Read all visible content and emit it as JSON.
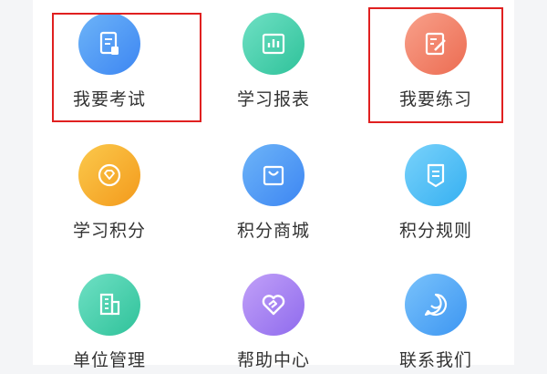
{
  "menu": {
    "items": [
      {
        "label": "我要考试",
        "icon": "exam-document-icon",
        "color_from": "#6db4f8",
        "color_to": "#3d86f2",
        "highlighted": true
      },
      {
        "label": "学习报表",
        "icon": "report-chart-icon",
        "color_from": "#6fe0c4",
        "color_to": "#2fc29a",
        "highlighted": false
      },
      {
        "label": "我要练习",
        "icon": "practice-edit-icon",
        "color_from": "#f8a08a",
        "color_to": "#ec6c52",
        "highlighted": true
      },
      {
        "label": "学习积分",
        "icon": "points-diamond-icon",
        "color_from": "#fbc94c",
        "color_to": "#f39a1c",
        "highlighted": false
      },
      {
        "label": "积分商城",
        "icon": "shop-bag-icon",
        "color_from": "#6db4f8",
        "color_to": "#3d86f2",
        "highlighted": false
      },
      {
        "label": "积分规则",
        "icon": "rules-badge-icon",
        "color_from": "#79d2fb",
        "color_to": "#36b0f1",
        "highlighted": false
      },
      {
        "label": "单位管理",
        "icon": "building-icon",
        "color_from": "#6fe0c4",
        "color_to": "#2fc29a",
        "highlighted": false
      },
      {
        "label": "帮助中心",
        "icon": "help-heart-icon",
        "color_from": "#c1a0f8",
        "color_to": "#8f6bed",
        "highlighted": false
      },
      {
        "label": "联系我们",
        "icon": "contact-chat-icon",
        "color_from": "#79c2fb",
        "color_to": "#3d96f2",
        "highlighted": false
      }
    ]
  },
  "annotation_color": "#e02020"
}
